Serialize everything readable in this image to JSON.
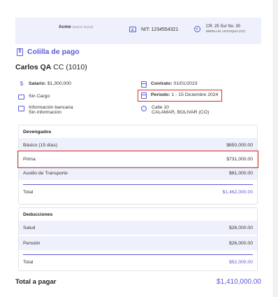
{
  "header": {
    "company": "Acme",
    "company_sub": "(Razón Social)",
    "nit": "NIT: 1234554321",
    "address_line1": "CR. 25 Sur No. 30",
    "address_line2": "MEDELLIN, ANTIOQUIA (CO)"
  },
  "document": {
    "title": "Colilla de pago",
    "employee_name": "Carlos QA",
    "employee_id": "CC (1010)"
  },
  "info": {
    "salary_label": "Salario:",
    "salary_value": "$1,300,000",
    "position": "Sin Cargo",
    "bank_label": "Información bancaria",
    "bank_value": "Sin información",
    "contract_label": "Contrato:",
    "contract_value": "01/01/2023",
    "period_label": "Periodo:",
    "period_value": "1 - 15 Diciembre 2024",
    "work_address1": "Calle 10",
    "work_address2": "CALAMAR, BOLIVAR (CO)"
  },
  "devengados": {
    "title": "Devengados",
    "rows": [
      {
        "label": "Básico (15 días)",
        "value": "$650,000.00"
      },
      {
        "label": "Prima",
        "value": "$731,000.00"
      },
      {
        "label": "Auxilio de Transporte",
        "value": "$81,000.00"
      }
    ],
    "total_label": "Total",
    "total_value": "$1,462,000.00"
  },
  "deducciones": {
    "title": "Deducciones",
    "rows": [
      {
        "label": "Salud",
        "value": "$26,000.00"
      },
      {
        "label": "Pensión",
        "value": "$26,000.00"
      }
    ],
    "total_label": "Total",
    "total_value": "$52,000.00"
  },
  "total_pay": {
    "label": "Total a pagar",
    "value": "$1,410,000.00"
  },
  "colors": {
    "accent": "#5b5bd6",
    "highlight": "#d93025",
    "row_alt": "#eef0fb"
  }
}
